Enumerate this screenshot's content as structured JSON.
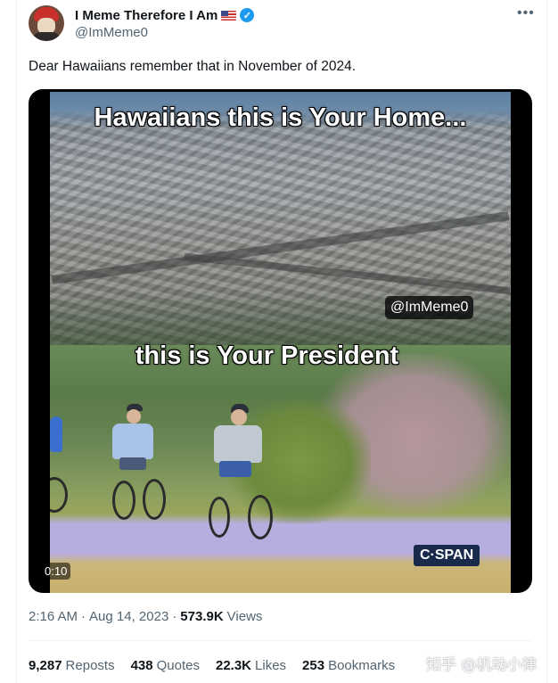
{
  "author": {
    "name": "I Meme Therefore I Am",
    "flag_icon": "us-flag-icon",
    "verified_icon": "verified-badge-icon",
    "handle": "@ImMeme0"
  },
  "more_label": "•••",
  "tweet_text": "Dear Hawaiians remember that in November of 2024.",
  "media": {
    "caption_top": "Hawaiians this is Your Home...",
    "caption_bottom": "this is Your President",
    "watermark": "@ImMeme0",
    "network_logo": "C·SPAN",
    "timecode": "0:10"
  },
  "meta": {
    "time": "2:16 AM",
    "sep1": "·",
    "date": "Aug 14, 2023",
    "sep2": "·",
    "views_count": "573.9K",
    "views_label": "Views"
  },
  "stats": [
    {
      "count": "9,287",
      "label": "Reposts"
    },
    {
      "count": "438",
      "label": "Quotes"
    },
    {
      "count": "22.3K",
      "label": "Likes"
    },
    {
      "count": "253",
      "label": "Bookmarks"
    }
  ],
  "source_watermark": "知乎 @机动小律",
  "colors": {
    "link_blue": "#1d9bf0",
    "text_primary": "#0f1419",
    "text_secondary": "#536471"
  }
}
